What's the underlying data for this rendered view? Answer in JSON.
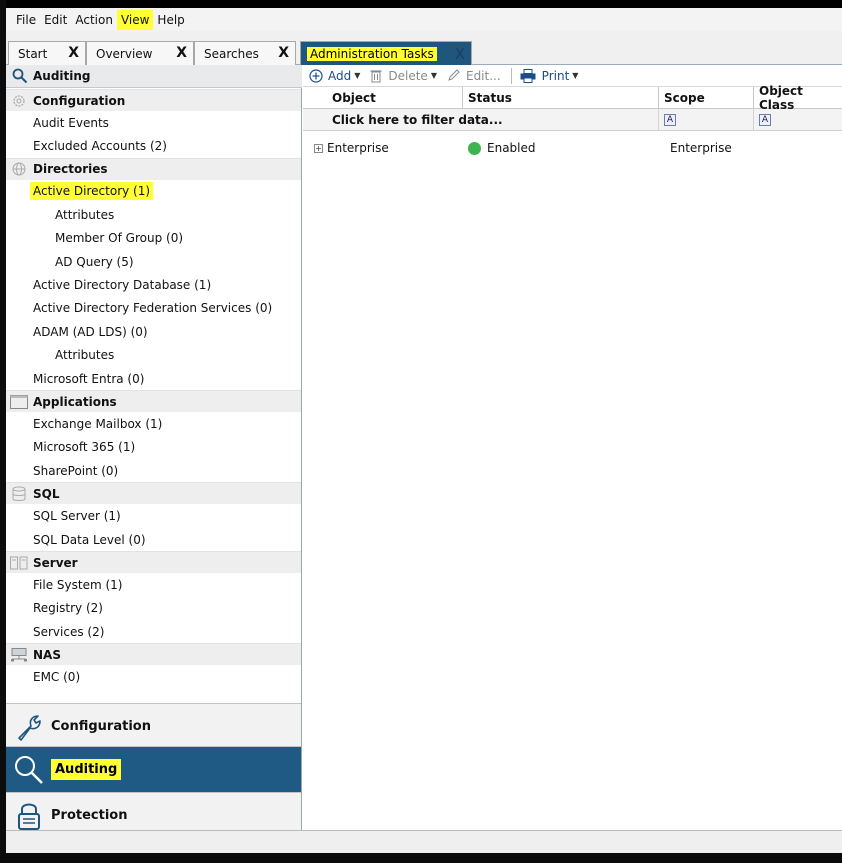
{
  "menu": [
    "File",
    "Edit",
    "Action",
    "View",
    "Help"
  ],
  "menu_highlight": "View",
  "tabs": {
    "start": "Start",
    "overview": "Overview",
    "searches": "Searches",
    "admin": "Administration Tasks",
    "close_glyph": "X"
  },
  "nav": {
    "header": "Auditing",
    "tree": [
      {
        "type": "section",
        "icon": "gear-icon",
        "label": "Configuration"
      },
      {
        "type": "item",
        "label": "Audit Events"
      },
      {
        "type": "item",
        "label": "Excluded Accounts (2)"
      },
      {
        "type": "section",
        "icon": "globe-icon",
        "label": "Directories"
      },
      {
        "type": "item",
        "label": "Active Directory (1)",
        "highlight": true
      },
      {
        "type": "sub",
        "label": "Attributes"
      },
      {
        "type": "sub",
        "label": "Member Of Group (0)"
      },
      {
        "type": "sub",
        "label": "AD Query (5)"
      },
      {
        "type": "item",
        "label": "Active Directory Database (1)"
      },
      {
        "type": "item",
        "label": "Active Directory Federation Services (0)"
      },
      {
        "type": "item",
        "label": "ADAM (AD LDS) (0)"
      },
      {
        "type": "sub",
        "label": "Attributes"
      },
      {
        "type": "item",
        "label": "Microsoft Entra (0)"
      },
      {
        "type": "section",
        "icon": "window-icon",
        "label": "Applications"
      },
      {
        "type": "item",
        "label": "Exchange Mailbox (1)"
      },
      {
        "type": "item",
        "label": "Microsoft 365 (1)"
      },
      {
        "type": "item",
        "label": "SharePoint (0)"
      },
      {
        "type": "section",
        "icon": "database-icon",
        "label": "SQL"
      },
      {
        "type": "item",
        "label": "SQL Server (1)"
      },
      {
        "type": "item",
        "label": "SQL Data Level (0)"
      },
      {
        "type": "section",
        "icon": "server-icon",
        "label": "Server"
      },
      {
        "type": "item",
        "label": "File System (1)"
      },
      {
        "type": "item",
        "label": "Registry (2)"
      },
      {
        "type": "item",
        "label": "Services (2)"
      },
      {
        "type": "section",
        "icon": "nas-icon",
        "label": "NAS"
      },
      {
        "type": "item",
        "label": "EMC (0)"
      }
    ],
    "bottom": {
      "configuration": "Configuration",
      "auditing": "Auditing",
      "protection": "Protection"
    }
  },
  "toolbar": {
    "add": "Add",
    "delete": "Delete",
    "edit": "Edit...",
    "print": "Print"
  },
  "grid": {
    "columns": [
      "Object",
      "Status",
      "Scope",
      "Object Class"
    ],
    "filter_text": "Click here to filter data...",
    "filter_icon_glyph": "A",
    "rows": [
      {
        "object": "Enterprise",
        "status": "Enabled",
        "scope": "Enterprise",
        "object_class": ""
      }
    ]
  },
  "colors": {
    "highlight": "#ffff33",
    "accent_blue": "#1f567e",
    "enabled_green": "#3fb34f"
  }
}
